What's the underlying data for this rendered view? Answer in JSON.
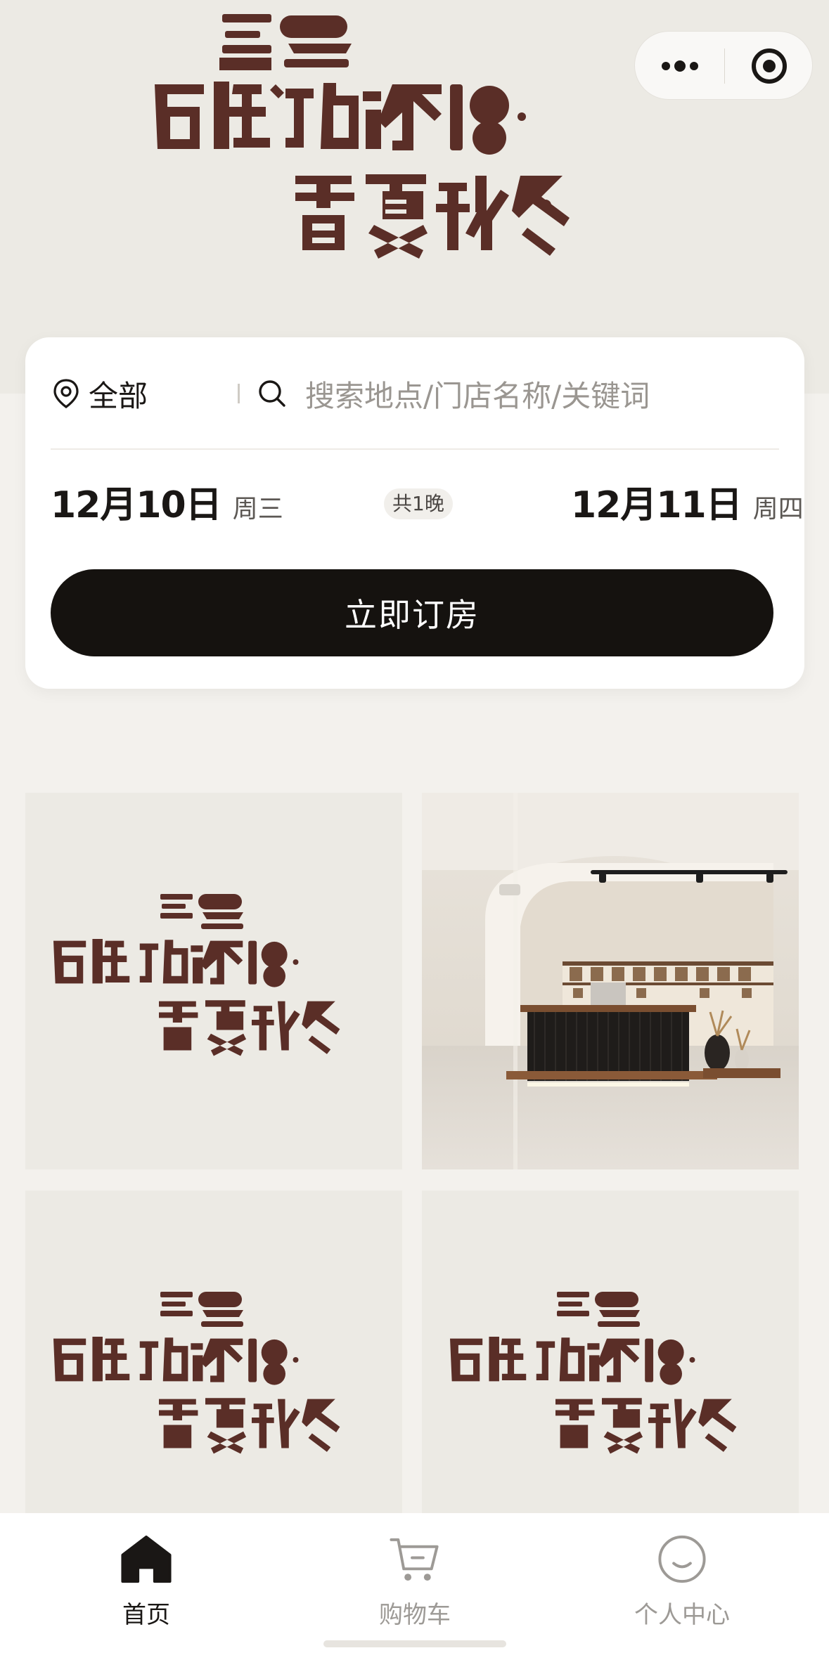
{
  "header": {
    "brand_name": "后陡门的家18·春夏秋冬",
    "capsule": {
      "more_icon": "more-dots-icon",
      "close_icon": "target-close-icon"
    }
  },
  "search_card": {
    "location_label": "全部",
    "search_placeholder": "搜索地点/门店名称/关键词",
    "checkin": {
      "date": "12月10日",
      "weekday": "周三"
    },
    "nights": "共1晚",
    "checkout": {
      "date": "12月11日",
      "weekday": "周四"
    },
    "book_button": "立即订房"
  },
  "gallery": [
    {
      "kind": "logo"
    },
    {
      "kind": "photo",
      "subject": "hotel lobby reception"
    },
    {
      "kind": "logo"
    },
    {
      "kind": "logo"
    }
  ],
  "tabbar": {
    "items": [
      {
        "label": "首页",
        "icon": "home-icon",
        "active": true
      },
      {
        "label": "购物车",
        "icon": "cart-icon",
        "active": false
      },
      {
        "label": "个人中心",
        "icon": "smiley-icon",
        "active": false
      }
    ]
  },
  "colors": {
    "brand": "#5a2e27",
    "primary_button": "#15120f",
    "background": "#f3f1ed"
  }
}
